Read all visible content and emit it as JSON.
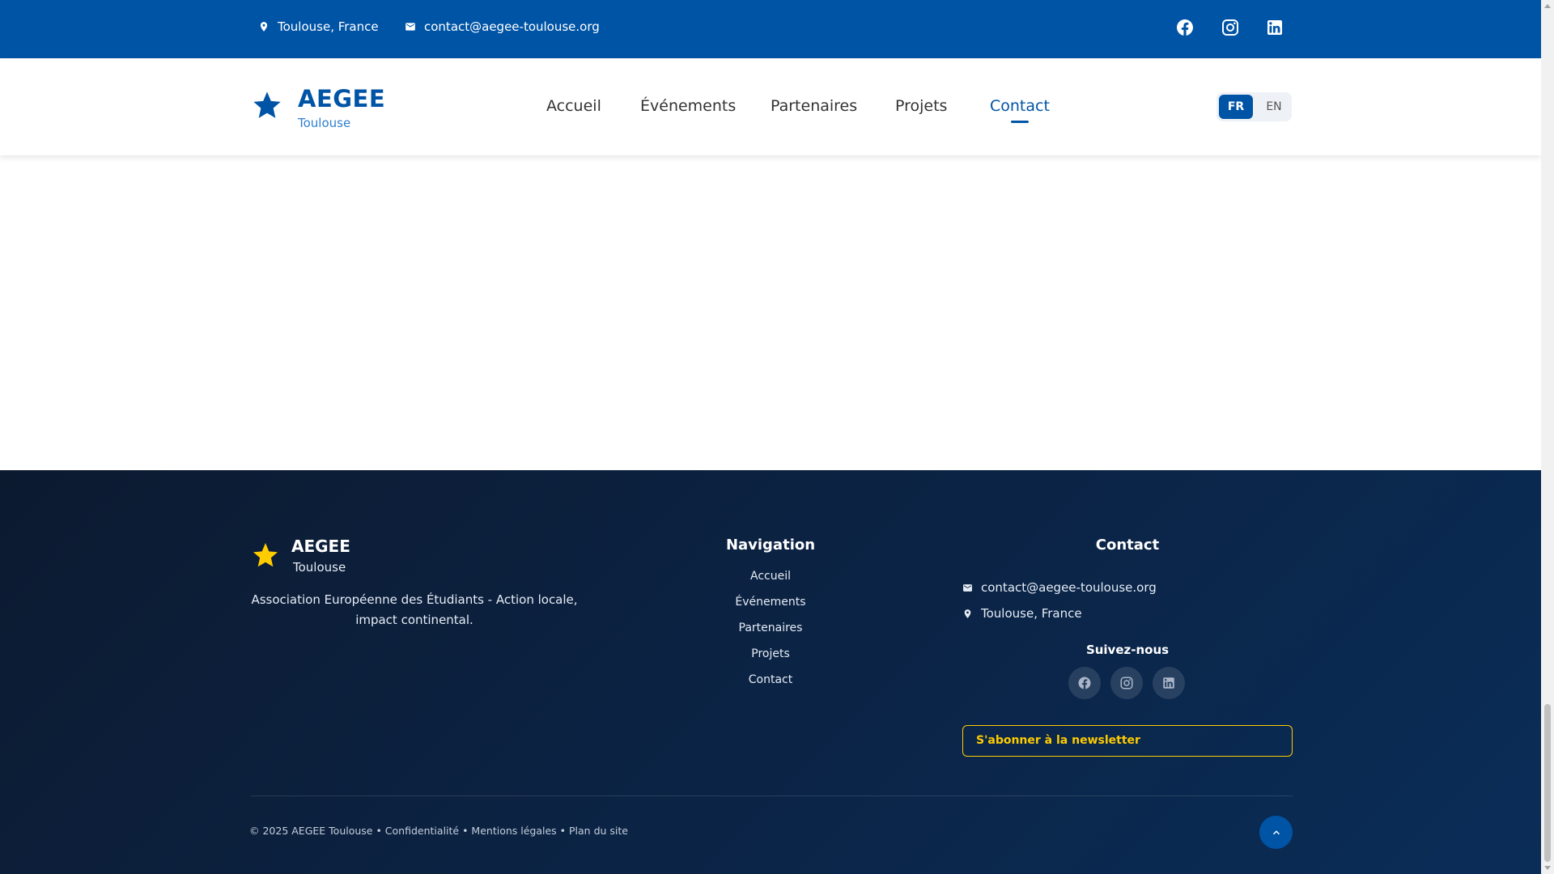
{
  "topbar": {
    "location": "Toulouse, France",
    "email": "contact@aegee-toulouse.org",
    "social": [
      "facebook-icon",
      "instagram-icon",
      "linkedin-icon"
    ]
  },
  "header": {
    "logo_title": "AEGEE",
    "logo_subtitle": "Toulouse",
    "nav": [
      "Accueil",
      "Événements",
      "Partenaires",
      "Projets",
      "Contact"
    ],
    "active_nav": "Contact",
    "lang": {
      "fr": "FR",
      "en": "EN",
      "selected": "FR"
    }
  },
  "footer": {
    "logo_title": "AEGEE",
    "logo_subtitle": "Toulouse",
    "description": "Association Européenne des Étudiants - Action locale, impact continental.",
    "navigation_heading": "Navigation",
    "navigation_links": [
      "Accueil",
      "Événements",
      "Partenaires",
      "Projets",
      "Contact"
    ],
    "contact_heading": "Contact",
    "contact_email": "contact@aegee-toulouse.org",
    "contact_location": "Toulouse, France",
    "follow_heading": "Suivez-nous",
    "newsletter_label": "S'abonner à la newsletter",
    "copyright": "© 2025 AEGEE Toulouse • Confidentialité • Mentions légales • Plan du site"
  },
  "colors": {
    "brand_blue": "#0054a6",
    "accent_yellow": "#ffcc00",
    "footer_dark": "#0b2446"
  }
}
